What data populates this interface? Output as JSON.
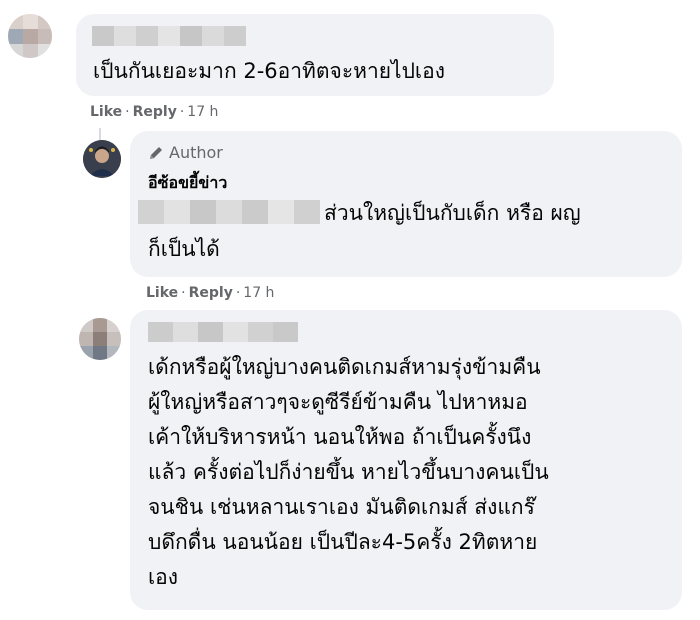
{
  "comments": [
    {
      "text": "เป็นกันเยอะมาก 2-6อาทิตจะหายไปเอง",
      "actions": {
        "like": "Like",
        "reply": "Reply",
        "time": "17 h"
      }
    },
    {
      "badge": "Author",
      "name": "อีซ้อขยี้ข่าว",
      "text_lines": [
        "ส่วนใหญ่เป็นกับเด็ก หรือ ผญ",
        "ก็เป็นได้"
      ],
      "actions": {
        "like": "Like",
        "reply": "Reply",
        "time": "17 h"
      }
    },
    {
      "text_lines": [
        "เด้กหรือผู้ใหญ่บางคนติดเกมส์หามรุ่งข้ามคืน",
        "ผู้ใหญ่หรือสาวๆจะดูซีรีย์ข้ามคืน ไปหาหมอ",
        "เค้าให้บริหารหน้า นอนให้พอ ถ้าเป็นครั้งนึง",
        "แล้ว ครั้งต่อไปก็ง่ายขึ้น หายไวขึ้นบางคนเป็น",
        "จนชิน เช่นหลานเราเอง มันติดเกมส์ ส่งแกร๊",
        "บดึกดื่น นอนน้อย เป็นปีละ4-5ครั้ง 2ทิตหาย",
        "เอง"
      ]
    }
  ],
  "icons": {
    "author_badge": "pencil-icon"
  },
  "colors": {
    "bubble": "#f0f2f5",
    "meta": "#65676b",
    "text": "#050505"
  }
}
